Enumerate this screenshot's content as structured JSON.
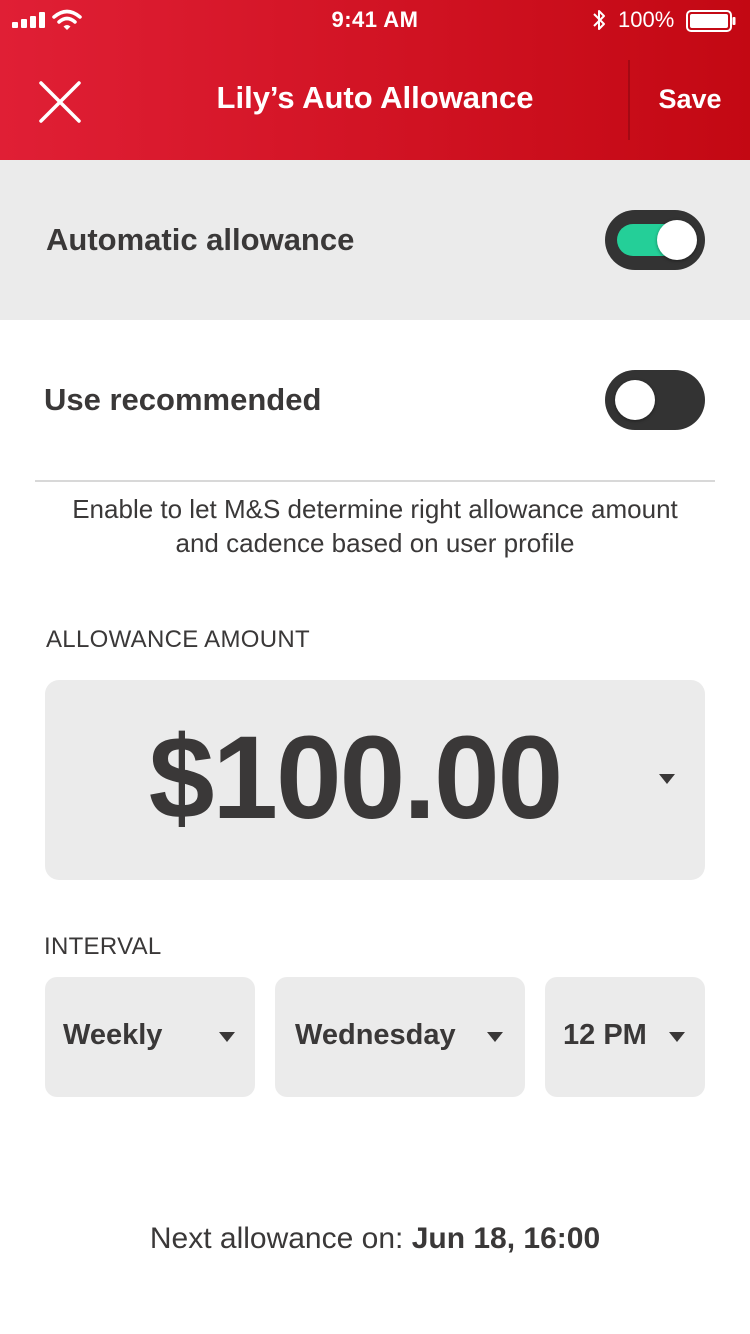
{
  "status_bar": {
    "time": "9:41 AM",
    "battery": "100%",
    "icons": [
      "signal-icon",
      "wifi-icon",
      "bluetooth-icon",
      "battery-icon"
    ]
  },
  "header": {
    "title": "Lily’s Auto Allowance",
    "save_label": "Save",
    "close_icon": "close-icon",
    "background": "#d71427"
  },
  "automatic_allowance": {
    "label": "Automatic allowance",
    "enabled": true
  },
  "use_recommended": {
    "label": "Use recommended",
    "enabled": false,
    "helper": "Enable to let M&S determine right allowance amount and cadence based on user profile"
  },
  "allowance_amount": {
    "label": "ALLOWANCE AMOUNT",
    "value": "$100.00"
  },
  "interval": {
    "label": "INTERVAL",
    "frequency": "Weekly",
    "day": "Wednesday",
    "time": "12 PM"
  },
  "next_allowance": {
    "prefix": "Next allowance on:",
    "value": "Jun 18, 16:00"
  },
  "colors": {
    "accent": "#d71427",
    "toggle_on": "#24cf98",
    "toggle_bg": "#333333",
    "panel": "#ebebeb",
    "text": "#3a3838"
  }
}
